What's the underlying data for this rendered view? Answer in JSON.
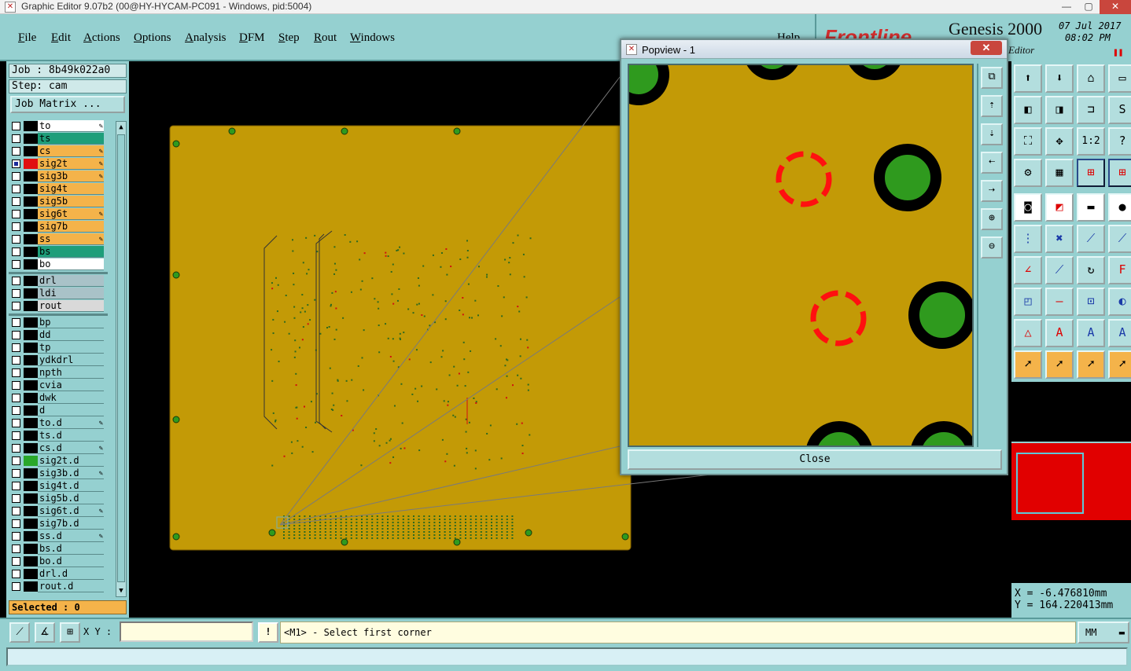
{
  "window": {
    "title": "Graphic Editor 9.07b2 (00@HY-HYCAM-PC091 - Windows, pid:5004)",
    "min": "—",
    "max": "▢",
    "close": "✕"
  },
  "menu": [
    "File",
    "Edit",
    "Actions",
    "Options",
    "Analysis",
    "DFM",
    "Step",
    "Rout",
    "Windows"
  ],
  "brand": {
    "help": "Help",
    "logo": "Frontline",
    "product": "Genesis 2000",
    "subtitle": "Editor",
    "date": "07 Jul 2017",
    "time": "08:02 PM"
  },
  "job": {
    "job_line": "Job : 8b49k022a0",
    "step_line": "Step: cam",
    "matrix_button": "Job Matrix ..."
  },
  "layers": [
    {
      "name": "to",
      "bg": "#ffffff",
      "edit": true,
      "checked": false,
      "swatch": "#000000"
    },
    {
      "name": "ts",
      "bg": "#1e9e7a",
      "edit": false,
      "checked": false,
      "swatch": "#000000"
    },
    {
      "name": "cs",
      "bg": "#f4b34a",
      "edit": true,
      "checked": false,
      "swatch": "#000000"
    },
    {
      "name": "sig2t",
      "bg": "#f4b34a",
      "edit": true,
      "checked": true,
      "swatch": "#e01010"
    },
    {
      "name": "sig3b",
      "bg": "#f4b34a",
      "edit": true,
      "checked": false,
      "swatch": "#000000"
    },
    {
      "name": "sig4t",
      "bg": "#f4b34a",
      "edit": false,
      "checked": false,
      "swatch": "#000000"
    },
    {
      "name": "sig5b",
      "bg": "#f4b34a",
      "edit": false,
      "checked": false,
      "swatch": "#000000"
    },
    {
      "name": "sig6t",
      "bg": "#f4b34a",
      "edit": true,
      "checked": false,
      "swatch": "#000000"
    },
    {
      "name": "sig7b",
      "bg": "#f4b34a",
      "edit": false,
      "checked": false,
      "swatch": "#000000"
    },
    {
      "name": "ss",
      "bg": "#f4b34a",
      "edit": true,
      "checked": false,
      "swatch": "#000000"
    },
    {
      "name": "bs",
      "bg": "#1e9e7a",
      "edit": false,
      "checked": false,
      "swatch": "#000000"
    },
    {
      "name": "bo",
      "bg": "#ffffff",
      "edit": false,
      "checked": false,
      "swatch": "#000000"
    },
    {
      "sep": true
    },
    {
      "name": "drl",
      "bg": "#a9c2c8",
      "edit": false,
      "checked": false,
      "swatch": "#000000"
    },
    {
      "name": "ldi",
      "bg": "#a9c2c8",
      "edit": false,
      "checked": false,
      "swatch": "#000000"
    },
    {
      "name": "rout",
      "bg": "#d9d9d9",
      "edit": false,
      "checked": false,
      "swatch": "#000000"
    },
    {
      "sep": true
    },
    {
      "name": "bp",
      "bg": "#95d0d0",
      "edit": false,
      "checked": false,
      "swatch": "#000000"
    },
    {
      "name": "dd",
      "bg": "#95d0d0",
      "edit": false,
      "checked": false,
      "swatch": "#000000"
    },
    {
      "name": "tp",
      "bg": "#95d0d0",
      "edit": false,
      "checked": false,
      "swatch": "#000000"
    },
    {
      "name": "ydkdrl",
      "bg": "#95d0d0",
      "edit": false,
      "checked": false,
      "swatch": "#000000"
    },
    {
      "name": "npth",
      "bg": "#95d0d0",
      "edit": false,
      "checked": false,
      "swatch": "#000000"
    },
    {
      "name": "cvia",
      "bg": "#95d0d0",
      "edit": false,
      "checked": false,
      "swatch": "#000000"
    },
    {
      "name": "dwk",
      "bg": "#95d0d0",
      "edit": false,
      "checked": false,
      "swatch": "#000000"
    },
    {
      "name": "d",
      "bg": "#95d0d0",
      "edit": false,
      "checked": false,
      "swatch": "#000000"
    },
    {
      "name": "to.d",
      "bg": "#95d0d0",
      "edit": true,
      "checked": false,
      "swatch": "#000000"
    },
    {
      "name": "ts.d",
      "bg": "#95d0d0",
      "edit": false,
      "checked": false,
      "swatch": "#000000"
    },
    {
      "name": "cs.d",
      "bg": "#95d0d0",
      "edit": true,
      "checked": false,
      "swatch": "#000000"
    },
    {
      "name": "sig2t.d",
      "bg": "#95d0d0",
      "edit": false,
      "checked": false,
      "swatch": "#2aa82a"
    },
    {
      "name": "sig3b.d",
      "bg": "#95d0d0",
      "edit": true,
      "checked": false,
      "swatch": "#000000"
    },
    {
      "name": "sig4t.d",
      "bg": "#95d0d0",
      "edit": false,
      "checked": false,
      "swatch": "#000000"
    },
    {
      "name": "sig5b.d",
      "bg": "#95d0d0",
      "edit": false,
      "checked": false,
      "swatch": "#000000"
    },
    {
      "name": "sig6t.d",
      "bg": "#95d0d0",
      "edit": true,
      "checked": false,
      "swatch": "#000000"
    },
    {
      "name": "sig7b.d",
      "bg": "#95d0d0",
      "edit": false,
      "checked": false,
      "swatch": "#000000"
    },
    {
      "name": "ss.d",
      "bg": "#95d0d0",
      "edit": true,
      "checked": false,
      "swatch": "#000000"
    },
    {
      "name": "bs.d",
      "bg": "#95d0d0",
      "edit": false,
      "checked": false,
      "swatch": "#000000"
    },
    {
      "name": "bo.d",
      "bg": "#95d0d0",
      "edit": false,
      "checked": false,
      "swatch": "#000000"
    },
    {
      "name": "drl.d",
      "bg": "#95d0d0",
      "edit": false,
      "checked": false,
      "swatch": "#000000"
    },
    {
      "name": "rout.d",
      "bg": "#95d0d0",
      "edit": false,
      "checked": false,
      "swatch": "#000000"
    }
  ],
  "selected": "Selected : 0",
  "popview": {
    "title": "Popview - 1",
    "close_x": "✕",
    "close_button": "Close"
  },
  "coords": {
    "x": "X = -6.476810mm",
    "y": "Y = 164.220413mm"
  },
  "cmd": {
    "xy_label": "X Y :",
    "xy_value": "",
    "warn": "!",
    "prompt": "<M1> - Select first corner",
    "units": "MM"
  },
  "colors": {
    "panel": "#95d0d0",
    "board": "#c39a06",
    "pad_green": "#2f9a1e",
    "target_red": "#ff1010",
    "overview_red": "#e10000"
  }
}
